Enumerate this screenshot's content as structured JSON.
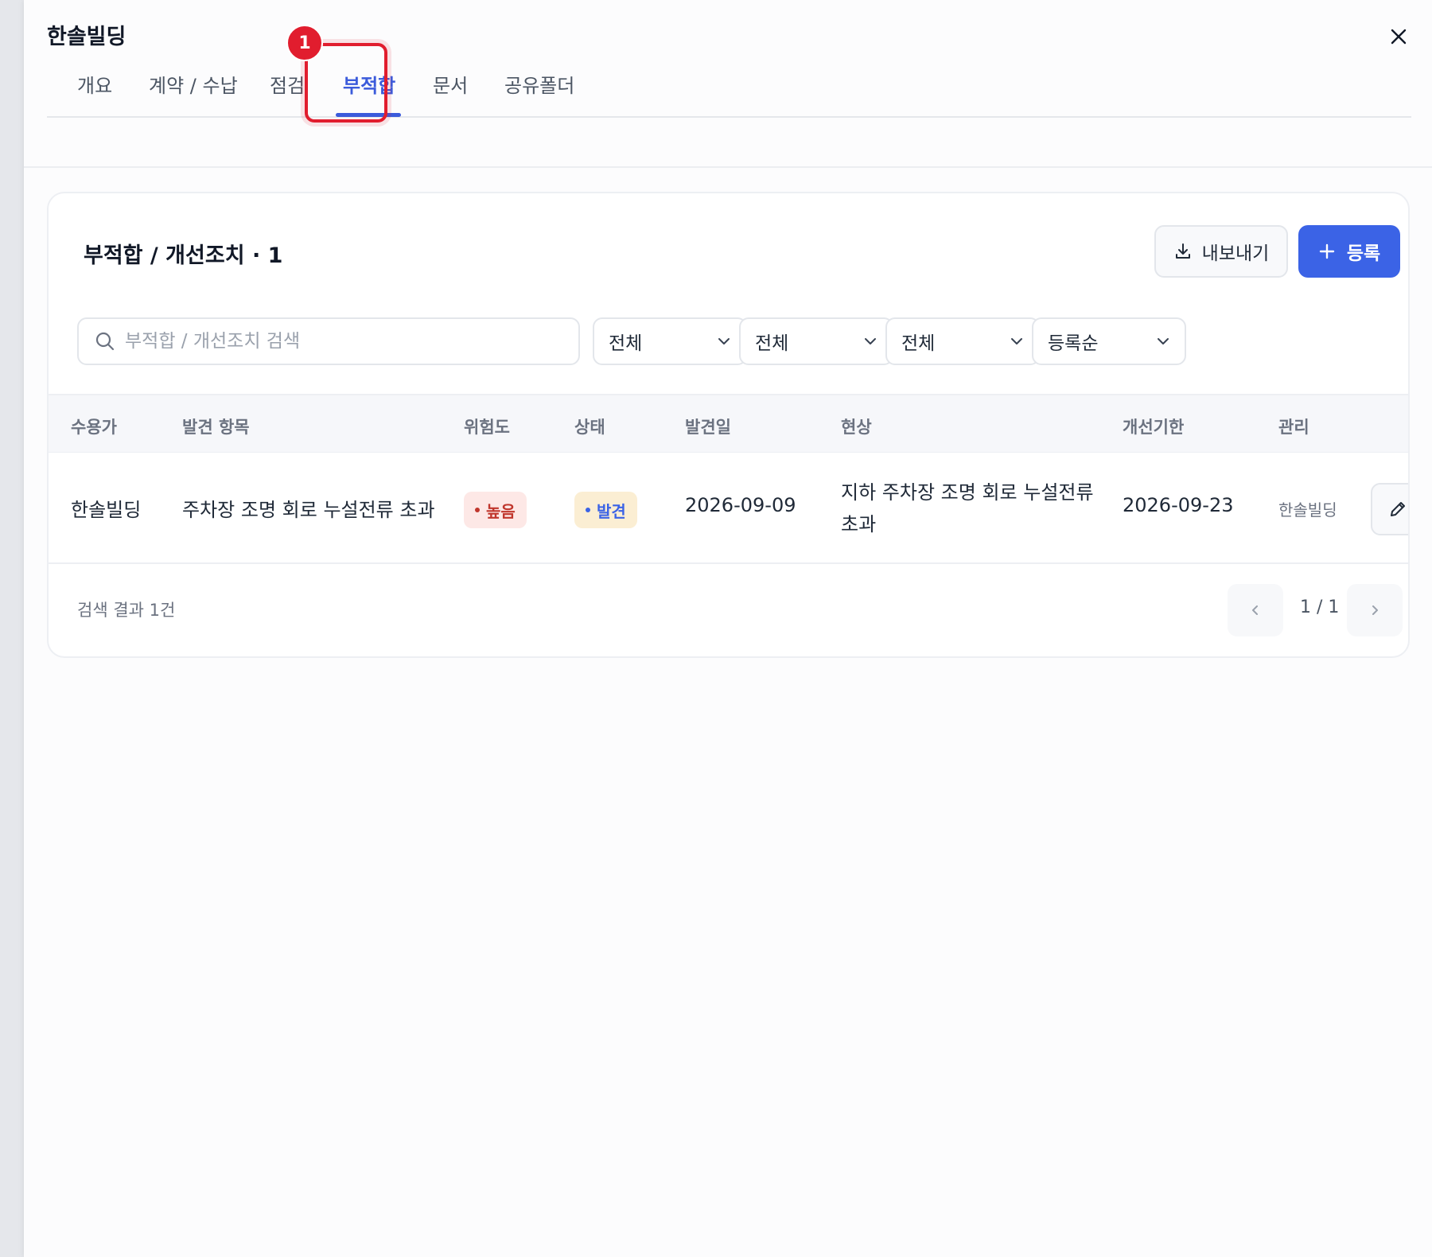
{
  "window": {
    "title": "한솔빌딩",
    "close_icon": "close-icon"
  },
  "tabs": [
    {
      "label": "개요"
    },
    {
      "label": "계약 / 수납"
    },
    {
      "label": "점검"
    },
    {
      "label": "부적합",
      "active": true
    },
    {
      "label": "문서"
    },
    {
      "label": "공유폴더"
    }
  ],
  "annotation": {
    "step": "1",
    "color": "#e11d2e"
  },
  "card": {
    "title": "부적합 / 개선조치 · 1",
    "export_label": "내보내기",
    "register_label": "등록",
    "accent": "#3b63e6"
  },
  "filters": {
    "search_placeholder": "부적합 / 개선조치 검색",
    "selects": [
      "전체",
      "전체",
      "전체",
      "등록순"
    ]
  },
  "table": {
    "columns": [
      "수용가",
      "발견 항목",
      "위험도",
      "상태",
      "발견일",
      "현상",
      "개선기한",
      "관리"
    ],
    "rows": [
      {
        "customer": "한솔빌딩",
        "item": "주차장 조명 회로 누설전류 초과",
        "risk": "높음",
        "status": "발견",
        "found_date": "2026-09-09",
        "symptom": "지하 주차장 조명 회로 누설전류 초과",
        "deadline": "2026-09-23",
        "manager": "한솔빌딩",
        "edit_label": "수"
      }
    ]
  },
  "footer": {
    "result_count": "검색 결과 1건",
    "page": "1 / 1"
  }
}
